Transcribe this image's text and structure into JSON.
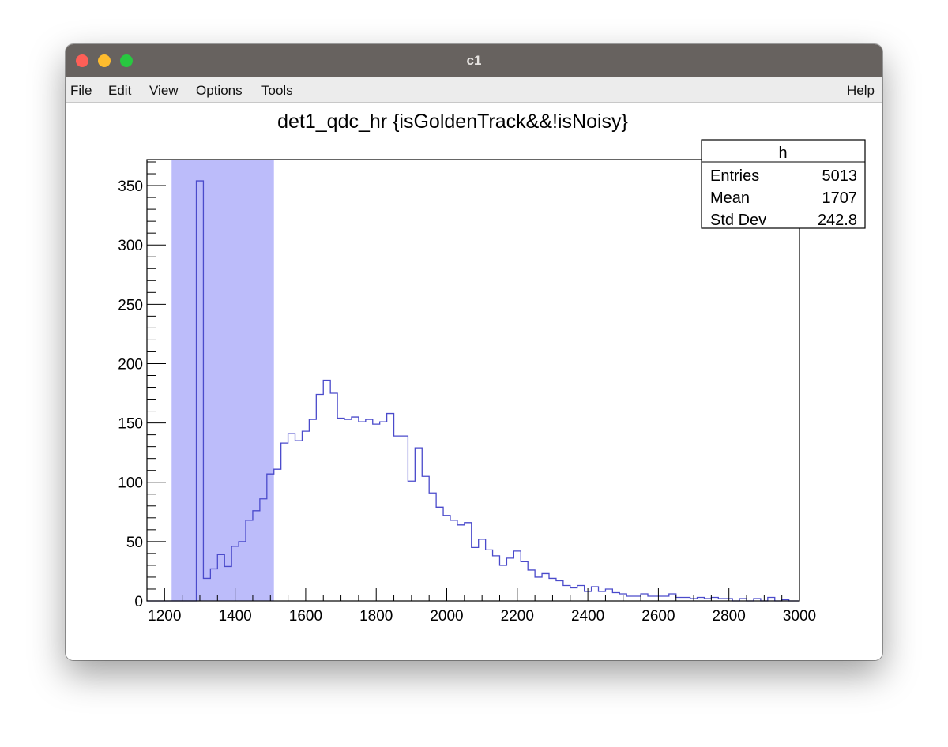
{
  "window": {
    "title": "c1",
    "controls": {
      "close_color": "#fe5f57",
      "minimize_color": "#febc2e",
      "maximize_color": "#28c840"
    }
  },
  "menu": {
    "items": [
      "File",
      "Edit",
      "View",
      "Options",
      "Tools"
    ],
    "help": "Help"
  },
  "stats_box": {
    "title": "h",
    "rows": [
      {
        "label": "Entries",
        "value": "5013"
      },
      {
        "label": "Mean",
        "value": "1707"
      },
      {
        "label": "Std Dev",
        "value": "242.8"
      }
    ]
  },
  "chart_data": {
    "type": "histogram",
    "title": "det1_qdc_hr {isGoldenTrack&&!isNoisy}",
    "xlabel": "",
    "ylabel": "",
    "xlim": [
      1150,
      3000
    ],
    "ylim": [
      0,
      372
    ],
    "x_ticks": [
      1200,
      1400,
      1600,
      1800,
      2000,
      2200,
      2400,
      2600,
      2800,
      3000
    ],
    "y_ticks": [
      0,
      50,
      100,
      150,
      200,
      250,
      300,
      350
    ],
    "highlight_range": [
      1220,
      1510
    ],
    "line_color": "#4a4acb",
    "highlight_color": "#bcbcfa",
    "bin_width": 20,
    "bin_edges_start": 1150,
    "counts": [
      0,
      0,
      0,
      0,
      0,
      0,
      0,
      354,
      19,
      27,
      39,
      29,
      46,
      50,
      68,
      76,
      86,
      107,
      111,
      133,
      141,
      135,
      143,
      153,
      174,
      186,
      175,
      154,
      153,
      155,
      151,
      153,
      149,
      151,
      158,
      139,
      139,
      101,
      129,
      105,
      91,
      79,
      72,
      68,
      64,
      66,
      45,
      52,
      43,
      38,
      30,
      36,
      42,
      33,
      26,
      20,
      23,
      19,
      17,
      13,
      11,
      13,
      8,
      12,
      8,
      10,
      7,
      6,
      4,
      4,
      6,
      4,
      4,
      4,
      6,
      3,
      3,
      2,
      3,
      2,
      3,
      2,
      2,
      0,
      2,
      0,
      2,
      0,
      3,
      0,
      1,
      0,
      0
    ]
  }
}
